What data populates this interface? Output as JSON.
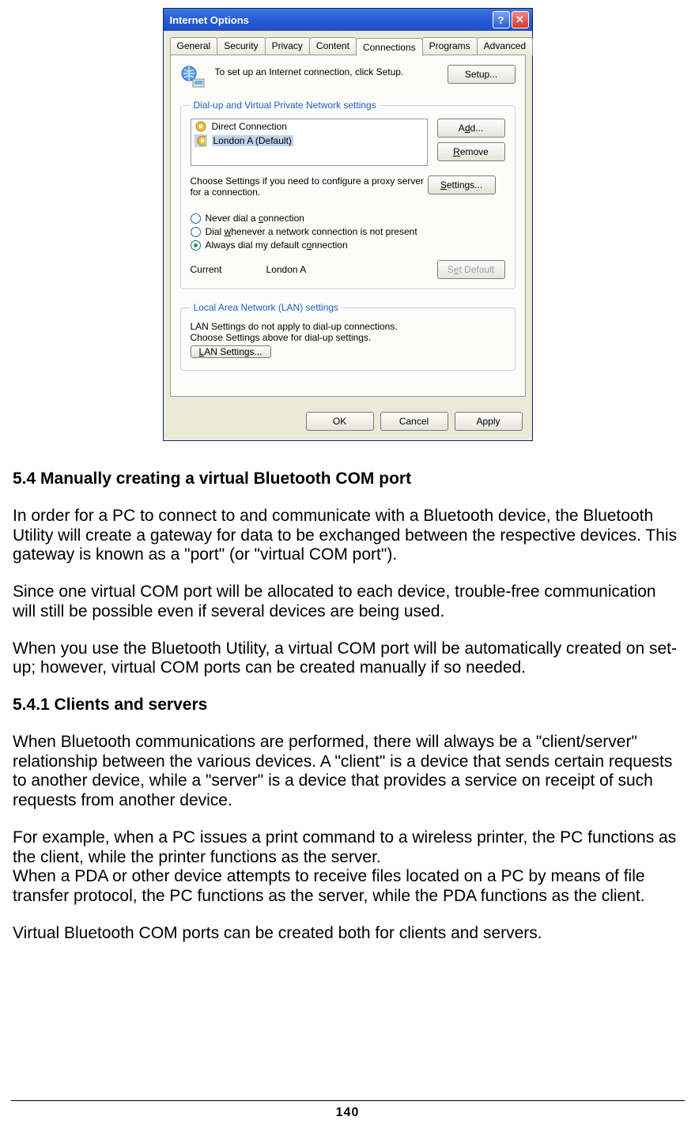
{
  "dialog": {
    "title": "Internet Options",
    "help_label": "?",
    "close_label": "✕",
    "tabs": [
      "General",
      "Security",
      "Privacy",
      "Content",
      "Connections",
      "Programs",
      "Advanced"
    ],
    "active_tab_index": 4,
    "setup_text": "To set up an Internet connection, click Setup.",
    "setup_btn": "Setup...",
    "group1": {
      "legend": "Dial-up and Virtual Private Network settings",
      "items": [
        {
          "label": "Direct Connection",
          "selected": false
        },
        {
          "label": "London A (Default)",
          "selected": true
        }
      ],
      "add_btn": "Add...",
      "remove_btn": "Remove",
      "settings_hint": "Choose Settings if you need to configure a proxy server for a connection.",
      "settings_btn": "Settings...",
      "radios": [
        {
          "label_pre": "Never dial a ",
          "mn": "c",
          "label_post": "onnection",
          "checked": false
        },
        {
          "label_pre": "Dial ",
          "mn": "w",
          "label_post": "henever a network connection is not present",
          "checked": false
        },
        {
          "label_pre": "Always dial my default c",
          "mn": "o",
          "label_post": "nnection",
          "checked": true
        }
      ],
      "current_label": "Current",
      "current_value": "London A",
      "set_default_btn": "Set Default"
    },
    "group2": {
      "legend": "Local Area Network (LAN) settings",
      "text": "LAN Settings do not apply to dial-up connections. Choose Settings above for dial-up settings.",
      "btn": "LAN Settings..."
    },
    "footer": {
      "ok": "OK",
      "cancel": "Cancel",
      "apply": "Apply"
    }
  },
  "doc": {
    "h1": "5.4  Manually creating a virtual Bluetooth COM port",
    "p1": "In order for a PC to connect to and communicate with a Bluetooth device, the Bluetooth Utility will create a gateway for data to be exchanged between the respective devices. This gateway is known as a \"port\" (or \"virtual COM port\").",
    "p2": "Since one virtual COM port will be allocated to each device, trouble-free communication will still be possible even if several devices are being used.",
    "p3": "When you use the Bluetooth Utility, a virtual COM port will be automatically created on set-up; however, virtual COM ports can be created manually if so needed.",
    "h2": "5.4.1    Clients and servers",
    "p4": "When Bluetooth communications are performed, there will always be a \"client/server\" relationship between the various devices. A \"client\" is a device that sends certain requests to another device, while a \"server\" is a device that provides a service on receipt of such requests from another device.",
    "p5a": "For example, when a PC issues a print command to a wireless printer, the PC functions as the client, while the printer functions as the server.",
    "p5b": "When a PDA or other device attempts to receive files located on a PC by means of file transfer protocol, the PC functions as the server, while the PDA functions as the client.",
    "p6": "Virtual Bluetooth COM ports can be created both for clients and servers."
  },
  "page_number": "140"
}
